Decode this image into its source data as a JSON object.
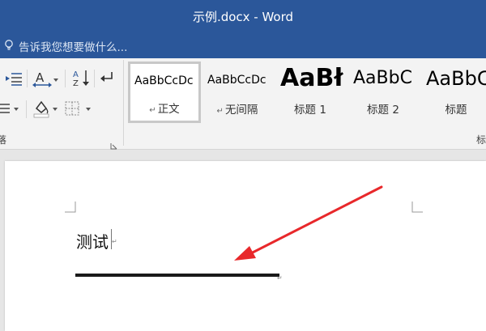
{
  "window": {
    "title": "示例.docx - Word"
  },
  "tell_me": {
    "placeholder": "告诉我您想要做什么..."
  },
  "ribbon": {
    "group_labels": {
      "paragraph_partial": "落",
      "styles_partial": "标"
    },
    "styles": [
      {
        "sample": "AaBbCcDc",
        "name": "正文",
        "selected": true
      },
      {
        "sample": "AaBbCcDc",
        "name": "无间隔",
        "selected": false
      },
      {
        "sample": "AaBł",
        "name": "标题 1",
        "selected": false
      },
      {
        "sample": "AaBbC",
        "name": "标题 2",
        "selected": false
      },
      {
        "sample": "AaBbC",
        "name": "标题",
        "selected": false
      }
    ]
  },
  "document": {
    "text": "测试",
    "paragraph_mark": "↵"
  },
  "annotation": {
    "arrow_color": "#e8282b"
  },
  "colors": {
    "title_bar": "#2b579a"
  }
}
